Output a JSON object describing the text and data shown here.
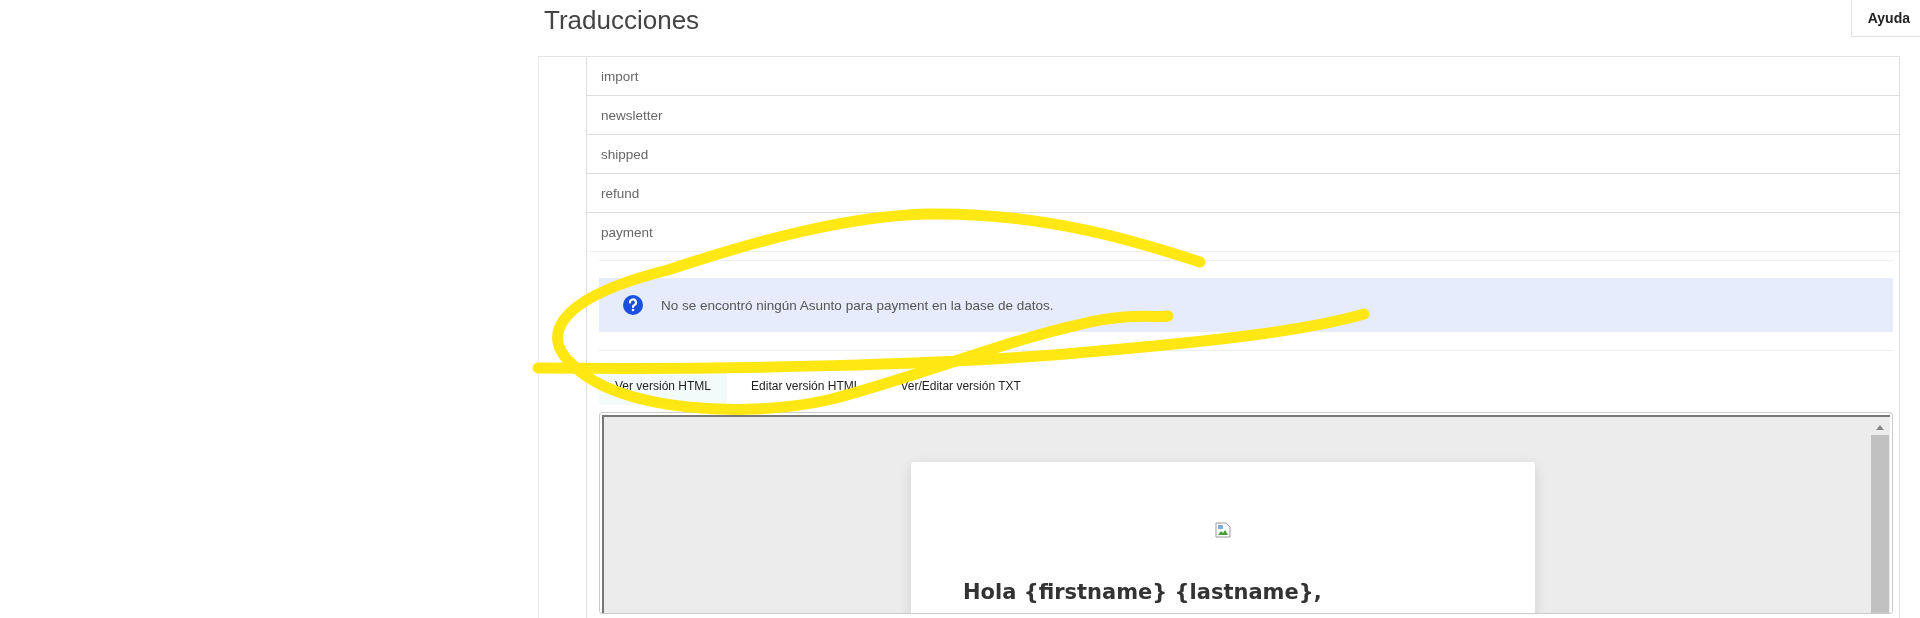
{
  "page": {
    "title": "Traducciones",
    "help_button": "Ayuda"
  },
  "templates": [
    {
      "name": "import",
      "expanded": false
    },
    {
      "name": "newsletter",
      "expanded": false
    },
    {
      "name": "shipped",
      "expanded": false
    },
    {
      "name": "refund",
      "expanded": false
    },
    {
      "name": "payment",
      "expanded": true
    }
  ],
  "alert": {
    "message": "No se encontró ningún Asunto para payment en la base de datos."
  },
  "editor_tabs": [
    {
      "label": "Ver versión HTML",
      "selected": true
    },
    {
      "label": "Editar versión HTML",
      "selected": false
    },
    {
      "label": "Ver/Editar versión TXT",
      "selected": false
    }
  ],
  "preview": {
    "greeting": "Hola {firstname} {lastname},"
  }
}
